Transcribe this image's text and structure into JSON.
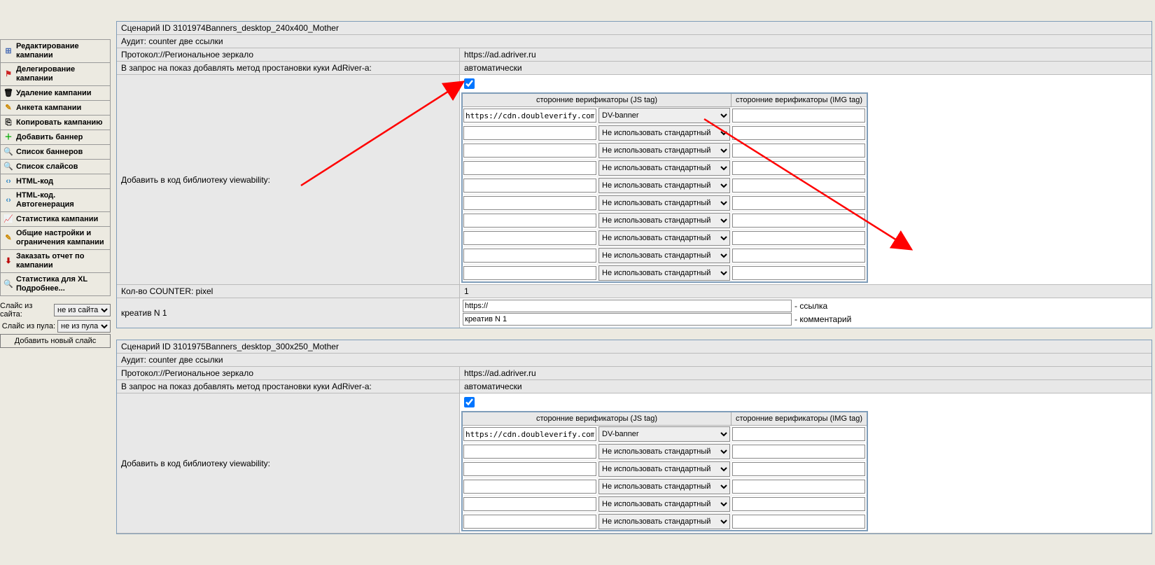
{
  "sidebar": {
    "items": [
      {
        "label": "Редактирование кампании"
      },
      {
        "label": "Делегирование кампании"
      },
      {
        "label": "Удаление кампании"
      },
      {
        "label": "Анкета кампании"
      },
      {
        "label": "Копировать кампанию"
      },
      {
        "label": "Добавить баннер"
      },
      {
        "label": "Список баннеров"
      },
      {
        "label": "Список слайсов"
      },
      {
        "label": "HTML-код"
      },
      {
        "label": "HTML-код. Автогенерация"
      },
      {
        "label": "Статистика кампании"
      },
      {
        "label": "Общие настройки и ограничения кампании"
      },
      {
        "label": "Заказать отчет по кампании"
      },
      {
        "label": "Статистика для XL Подробнее..."
      }
    ],
    "slice_site_label": "Слайс из сайта:",
    "slice_site_value": "не из сайта",
    "slice_pool_label": "Слайс из пула:",
    "slice_pool_value": "не из пула",
    "add_slice_btn": "Добавить новый слайс"
  },
  "scenario1": {
    "title": "Сценарий ID 3101974Banners_desktop_240x400_Mother",
    "audit": "Аудит: counter две ссылки",
    "protocol_label": "Протокол://Региональное зеркало",
    "protocol_value": "https://ad.adriver.ru",
    "cookie_label": "В запрос на показ добавлять метод простановки куки AdRiver-а:",
    "cookie_value": "автоматически",
    "viewab_label": "Добавить в код библиотеку viewability:",
    "counter_label": "Кол-во COUNTER: pixel",
    "counter_value": "1",
    "creative_label": "креатив N 1",
    "creative_link_value": "https://",
    "creative_link_suffix": "- ссылка",
    "creative_comment_value": "креатив N 1",
    "creative_comment_suffix": "- комментарий",
    "th_js": "сторонние верификаторы (JS tag)",
    "th_img": "сторонние верификаторы (IMG tag)",
    "rows": [
      {
        "url": "https://cdn.doubleverify.com/dvtp",
        "type": "DV-banner"
      },
      {
        "url": "",
        "type": "Не использовать стандартный"
      },
      {
        "url": "",
        "type": "Не использовать стандартный"
      },
      {
        "url": "",
        "type": "Не использовать стандартный"
      },
      {
        "url": "",
        "type": "Не использовать стандартный"
      },
      {
        "url": "",
        "type": "Не использовать стандартный"
      },
      {
        "url": "",
        "type": "Не использовать стандартный"
      },
      {
        "url": "",
        "type": "Не использовать стандартный"
      },
      {
        "url": "",
        "type": "Не использовать стандартный"
      },
      {
        "url": "",
        "type": "Не использовать стандартный"
      }
    ]
  },
  "scenario2": {
    "title": "Сценарий ID 3101975Banners_desktop_300x250_Mother",
    "audit": "Аудит: counter две ссылки",
    "protocol_label": "Протокол://Региональное зеркало",
    "protocol_value": "https://ad.adriver.ru",
    "cookie_label": "В запрос на показ добавлять метод простановки куки AdRiver-а:",
    "cookie_value": "автоматически",
    "viewab_label": "Добавить в код библиотеку viewability:",
    "th_js": "сторонние верификаторы (JS tag)",
    "th_img": "сторонние верификаторы (IMG tag)",
    "rows": [
      {
        "url": "https://cdn.doubleverify.com/dvtp",
        "type": "DV-banner"
      },
      {
        "url": "",
        "type": "Не использовать стандартный"
      },
      {
        "url": "",
        "type": "Не использовать стандартный"
      },
      {
        "url": "",
        "type": "Не использовать стандартный"
      },
      {
        "url": "",
        "type": "Не использовать стандартный"
      },
      {
        "url": "",
        "type": "Не использовать стандартный"
      }
    ]
  }
}
